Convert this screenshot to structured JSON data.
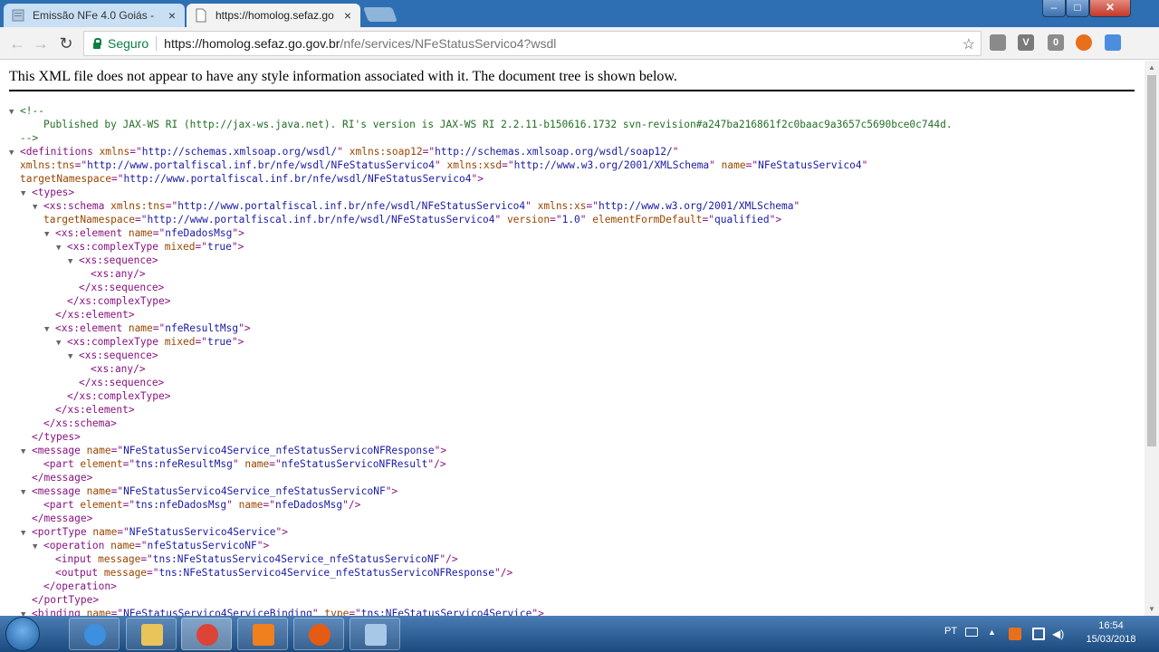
{
  "tabs": [
    {
      "title": "Emissão NFe 4.0 Goiás -  ",
      "close": "×"
    },
    {
      "title": "https://homolog.sefaz.go",
      "close": "×"
    }
  ],
  "window_controls": {
    "minimize": "–",
    "maximize": "□",
    "close": "✕"
  },
  "toolbar": {
    "back": "←",
    "forward": "→",
    "reload": "↻",
    "secure_label": "Seguro",
    "url_host": "https://homolog.sefaz.go.gov.br",
    "url_path": "/nfe/services/NFeStatusServico4?wsdl",
    "bookmark": "☆",
    "menu": "⋮"
  },
  "extensions": [
    {
      "name": "extension-1",
      "color": "#8a8a8a",
      "text": ""
    },
    {
      "name": "extension-2",
      "color": "#7a7a7a",
      "text": "V"
    },
    {
      "name": "extension-3",
      "color": "#8c8c8c",
      "text": "0"
    },
    {
      "name": "extension-4",
      "color": "#e8701a",
      "text": ""
    },
    {
      "name": "extension-5",
      "color": "#4d8de0",
      "text": ""
    }
  ],
  "notice": "This XML file does not appear to have any style information associated with it. The document tree is shown below.",
  "xml": [
    {
      "i": 0,
      "t": "▼",
      "parts": [
        [
          "cm",
          "<!--"
        ]
      ]
    },
    {
      "i": 2,
      "t": "",
      "parts": [
        [
          "cm",
          "Published by JAX-WS RI (http://jax-ws.java.net). RI's version is JAX-WS RI 2.2.11-b150616.1732 svn-revision#a247ba216861f2c0baac9a3657c5690bce0c744d."
        ]
      ]
    },
    {
      "i": 0,
      "t": "",
      "parts": [
        [
          "cm",
          "-->"
        ]
      ]
    },
    {
      "i": 0,
      "t": "▼",
      "parts": [
        [
          "tg",
          "<definitions "
        ],
        [
          "an",
          "xmlns"
        ],
        [
          "tg",
          "=\""
        ],
        [
          "av",
          "http://schemas.xmlsoap.org/wsdl/"
        ],
        [
          "tg",
          "\" "
        ],
        [
          "an",
          "xmlns:soap12"
        ],
        [
          "tg",
          "=\""
        ],
        [
          "av",
          "http://schemas.xmlsoap.org/wsdl/soap12/"
        ],
        [
          "tg",
          "\""
        ]
      ]
    },
    {
      "i": 0,
      "t": " ",
      "parts": [
        [
          "an",
          "xmlns:tns"
        ],
        [
          "tg",
          "=\""
        ],
        [
          "av",
          "http://www.portalfiscal.inf.br/nfe/wsdl/NFeStatusServico4"
        ],
        [
          "tg",
          "\" "
        ],
        [
          "an",
          "xmlns:xsd"
        ],
        [
          "tg",
          "=\""
        ],
        [
          "av",
          "http://www.w3.org/2001/XMLSchema"
        ],
        [
          "tg",
          "\" "
        ],
        [
          "an",
          "name"
        ],
        [
          "tg",
          "=\""
        ],
        [
          "av",
          "NFeStatusServico4"
        ],
        [
          "tg",
          "\""
        ]
      ]
    },
    {
      "i": 0,
      "t": " ",
      "parts": [
        [
          "an",
          "targetNamespace"
        ],
        [
          "tg",
          "=\""
        ],
        [
          "av",
          "http://www.portalfiscal.inf.br/nfe/wsdl/NFeStatusServico4"
        ],
        [
          "tg",
          "\">"
        ]
      ]
    },
    {
      "i": 1,
      "t": "▼",
      "parts": [
        [
          "tg",
          "<types>"
        ]
      ]
    },
    {
      "i": 2,
      "t": "▼",
      "parts": [
        [
          "tg",
          "<xs:schema "
        ],
        [
          "an",
          "xmlns:tns"
        ],
        [
          "tg",
          "=\""
        ],
        [
          "av",
          "http://www.portalfiscal.inf.br/nfe/wsdl/NFeStatusServico4"
        ],
        [
          "tg",
          "\" "
        ],
        [
          "an",
          "xmlns:xs"
        ],
        [
          "tg",
          "=\""
        ],
        [
          "av",
          "http://www.w3.org/2001/XMLSchema"
        ],
        [
          "tg",
          "\""
        ]
      ]
    },
    {
      "i": 2,
      "t": " ",
      "parts": [
        [
          "an",
          "targetNamespace"
        ],
        [
          "tg",
          "=\""
        ],
        [
          "av",
          "http://www.portalfiscal.inf.br/nfe/wsdl/NFeStatusServico4"
        ],
        [
          "tg",
          "\" "
        ],
        [
          "an",
          "version"
        ],
        [
          "tg",
          "=\""
        ],
        [
          "av",
          "1.0"
        ],
        [
          "tg",
          "\" "
        ],
        [
          "an",
          "elementFormDefault"
        ],
        [
          "tg",
          "=\""
        ],
        [
          "av",
          "qualified"
        ],
        [
          "tg",
          "\">"
        ]
      ]
    },
    {
      "i": 3,
      "t": "▼",
      "parts": [
        [
          "tg",
          "<xs:element "
        ],
        [
          "an",
          "name"
        ],
        [
          "tg",
          "=\""
        ],
        [
          "av",
          "nfeDadosMsg"
        ],
        [
          "tg",
          "\">"
        ]
      ]
    },
    {
      "i": 4,
      "t": "▼",
      "parts": [
        [
          "tg",
          "<xs:complexType "
        ],
        [
          "an",
          "mixed"
        ],
        [
          "tg",
          "=\""
        ],
        [
          "av",
          "true"
        ],
        [
          "tg",
          "\">"
        ]
      ]
    },
    {
      "i": 5,
      "t": "▼",
      "parts": [
        [
          "tg",
          "<xs:sequence>"
        ]
      ]
    },
    {
      "i": 6,
      "t": "",
      "parts": [
        [
          "tg",
          "<xs:any/>"
        ]
      ]
    },
    {
      "i": 5,
      "t": "",
      "parts": [
        [
          "tg",
          "</xs:sequence>"
        ]
      ]
    },
    {
      "i": 4,
      "t": "",
      "parts": [
        [
          "tg",
          "</xs:complexType>"
        ]
      ]
    },
    {
      "i": 3,
      "t": "",
      "parts": [
        [
          "tg",
          "</xs:element>"
        ]
      ]
    },
    {
      "i": 3,
      "t": "▼",
      "parts": [
        [
          "tg",
          "<xs:element "
        ],
        [
          "an",
          "name"
        ],
        [
          "tg",
          "=\""
        ],
        [
          "av",
          "nfeResultMsg"
        ],
        [
          "tg",
          "\">"
        ]
      ]
    },
    {
      "i": 4,
      "t": "▼",
      "parts": [
        [
          "tg",
          "<xs:complexType "
        ],
        [
          "an",
          "mixed"
        ],
        [
          "tg",
          "=\""
        ],
        [
          "av",
          "true"
        ],
        [
          "tg",
          "\">"
        ]
      ]
    },
    {
      "i": 5,
      "t": "▼",
      "parts": [
        [
          "tg",
          "<xs:sequence>"
        ]
      ]
    },
    {
      "i": 6,
      "t": "",
      "parts": [
        [
          "tg",
          "<xs:any/>"
        ]
      ]
    },
    {
      "i": 5,
      "t": "",
      "parts": [
        [
          "tg",
          "</xs:sequence>"
        ]
      ]
    },
    {
      "i": 4,
      "t": "",
      "parts": [
        [
          "tg",
          "</xs:complexType>"
        ]
      ]
    },
    {
      "i": 3,
      "t": "",
      "parts": [
        [
          "tg",
          "</xs:element>"
        ]
      ]
    },
    {
      "i": 2,
      "t": "",
      "parts": [
        [
          "tg",
          "</xs:schema>"
        ]
      ]
    },
    {
      "i": 1,
      "t": "",
      "parts": [
        [
          "tg",
          "</types>"
        ]
      ]
    },
    {
      "i": 1,
      "t": "▼",
      "parts": [
        [
          "tg",
          "<message "
        ],
        [
          "an",
          "name"
        ],
        [
          "tg",
          "=\""
        ],
        [
          "av",
          "NFeStatusServico4Service_nfeStatusServicoNFResponse"
        ],
        [
          "tg",
          "\">"
        ]
      ]
    },
    {
      "i": 2,
      "t": "",
      "parts": [
        [
          "tg",
          "<part "
        ],
        [
          "an",
          "element"
        ],
        [
          "tg",
          "=\""
        ],
        [
          "av",
          "tns:nfeResultMsg"
        ],
        [
          "tg",
          "\" "
        ],
        [
          "an",
          "name"
        ],
        [
          "tg",
          "=\""
        ],
        [
          "av",
          "nfeStatusServicoNFResult"
        ],
        [
          "tg",
          "\"/>"
        ]
      ]
    },
    {
      "i": 1,
      "t": "",
      "parts": [
        [
          "tg",
          "</message>"
        ]
      ]
    },
    {
      "i": 1,
      "t": "▼",
      "parts": [
        [
          "tg",
          "<message "
        ],
        [
          "an",
          "name"
        ],
        [
          "tg",
          "=\""
        ],
        [
          "av",
          "NFeStatusServico4Service_nfeStatusServicoNF"
        ],
        [
          "tg",
          "\">"
        ]
      ]
    },
    {
      "i": 2,
      "t": "",
      "parts": [
        [
          "tg",
          "<part "
        ],
        [
          "an",
          "element"
        ],
        [
          "tg",
          "=\""
        ],
        [
          "av",
          "tns:nfeDadosMsg"
        ],
        [
          "tg",
          "\" "
        ],
        [
          "an",
          "name"
        ],
        [
          "tg",
          "=\""
        ],
        [
          "av",
          "nfeDadosMsg"
        ],
        [
          "tg",
          "\"/>"
        ]
      ]
    },
    {
      "i": 1,
      "t": "",
      "parts": [
        [
          "tg",
          "</message>"
        ]
      ]
    },
    {
      "i": 1,
      "t": "▼",
      "parts": [
        [
          "tg",
          "<portType "
        ],
        [
          "an",
          "name"
        ],
        [
          "tg",
          "=\""
        ],
        [
          "av",
          "NFeStatusServico4Service"
        ],
        [
          "tg",
          "\">"
        ]
      ]
    },
    {
      "i": 2,
      "t": "▼",
      "parts": [
        [
          "tg",
          "<operation "
        ],
        [
          "an",
          "name"
        ],
        [
          "tg",
          "=\""
        ],
        [
          "av",
          "nfeStatusServicoNF"
        ],
        [
          "tg",
          "\">"
        ]
      ]
    },
    {
      "i": 3,
      "t": "",
      "parts": [
        [
          "tg",
          "<input "
        ],
        [
          "an",
          "message"
        ],
        [
          "tg",
          "=\""
        ],
        [
          "av",
          "tns:NFeStatusServico4Service_nfeStatusServicoNF"
        ],
        [
          "tg",
          "\"/>"
        ]
      ]
    },
    {
      "i": 3,
      "t": "",
      "parts": [
        [
          "tg",
          "<output "
        ],
        [
          "an",
          "message"
        ],
        [
          "tg",
          "=\""
        ],
        [
          "av",
          "tns:NFeStatusServico4Service_nfeStatusServicoNFResponse"
        ],
        [
          "tg",
          "\"/>"
        ]
      ]
    },
    {
      "i": 2,
      "t": "",
      "parts": [
        [
          "tg",
          "</operation>"
        ]
      ]
    },
    {
      "i": 1,
      "t": "",
      "parts": [
        [
          "tg",
          "</portType>"
        ]
      ]
    },
    {
      "i": 1,
      "t": "▼",
      "parts": [
        [
          "tg",
          "<binding "
        ],
        [
          "an",
          "name"
        ],
        [
          "tg",
          "=\""
        ],
        [
          "av",
          "NFeStatusServico4ServiceBinding"
        ],
        [
          "tg",
          "\" "
        ],
        [
          "an",
          "type"
        ],
        [
          "tg",
          "=\""
        ],
        [
          "av",
          "tns:NFeStatusServico4Service"
        ],
        [
          "tg",
          "\">"
        ]
      ]
    }
  ],
  "taskbar": {
    "apps": [
      {
        "name": "internet-explorer",
        "color": "#3d8fe0",
        "active": false
      },
      {
        "name": "file-explorer",
        "color": "#e8c45a",
        "active": false
      },
      {
        "name": "chrome",
        "color": "#db4437",
        "active": true
      },
      {
        "name": "media-player",
        "color": "#f07f1d",
        "active": false
      },
      {
        "name": "firefox",
        "color": "#e55b13",
        "active": false
      },
      {
        "name": "notes-app",
        "color": "#a8c8e8",
        "active": false
      }
    ],
    "lang": "PT",
    "time": "16:54",
    "date": "15/03/2018"
  },
  "colors": {
    "tag": "#881280",
    "attr_name": "#994500",
    "attr_value": "#1a1aa6",
    "comment": "#236e25",
    "tabbar": "#2e6fb4",
    "secure": "#0b8043"
  }
}
